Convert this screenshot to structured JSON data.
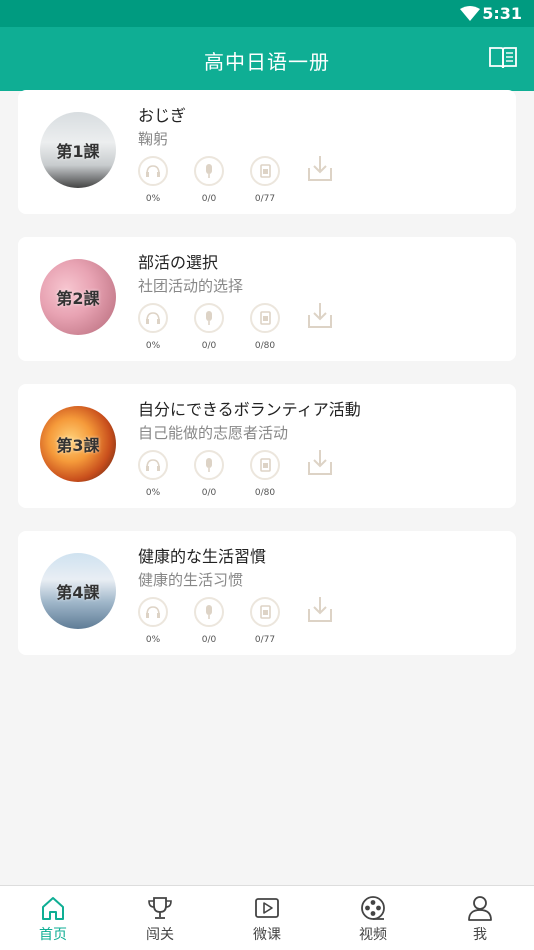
{
  "status": {
    "time": "5:31"
  },
  "header": {
    "title": "高中日语一册"
  },
  "lessons": [
    {
      "badge": "第1課",
      "title": "おじぎ",
      "subtitle": "鞠躬",
      "listen": "0%",
      "speak": "0/0",
      "words": "0/77"
    },
    {
      "badge": "第2課",
      "title": "部活の選択",
      "subtitle": "社团活动的选择",
      "listen": "0%",
      "speak": "0/0",
      "words": "0/80"
    },
    {
      "badge": "第3課",
      "title": "自分にできるボランティア活動",
      "subtitle": "自己能做的志愿者活动",
      "listen": "0%",
      "speak": "0/0",
      "words": "0/80"
    },
    {
      "badge": "第4課",
      "title": "健康的な生活習慣",
      "subtitle": "健康的生活习惯",
      "listen": "0%",
      "speak": "0/0",
      "words": "0/77"
    }
  ],
  "tabs": [
    {
      "label": "首页",
      "icon": "home-icon"
    },
    {
      "label": "闯关",
      "icon": "trophy-icon"
    },
    {
      "label": "微课",
      "icon": "play-icon"
    },
    {
      "label": "视频",
      "icon": "film-reel-icon"
    },
    {
      "label": "我",
      "icon": "person-icon"
    }
  ],
  "colors": {
    "primary": "#0fae94",
    "statusbar": "#009b80"
  }
}
